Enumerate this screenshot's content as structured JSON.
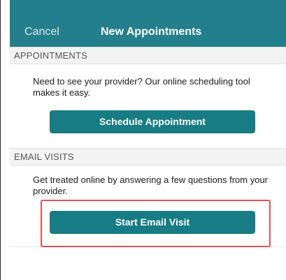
{
  "navbar": {
    "cancel_label": "Cancel",
    "title": "New Appointments"
  },
  "appointments": {
    "header": "APPOINTMENTS",
    "description": "Need to see your provider? Our online scheduling tool makes it easy.",
    "button_label": "Schedule Appointment"
  },
  "email_visits": {
    "header": "EMAIL VISITS",
    "description": "Get treated online by answering a few questions from your provider.",
    "button_label": "Start Email Visit"
  },
  "colors": {
    "navbar": "#227f8b",
    "button": "#177c84",
    "highlight": "#e5514f"
  }
}
